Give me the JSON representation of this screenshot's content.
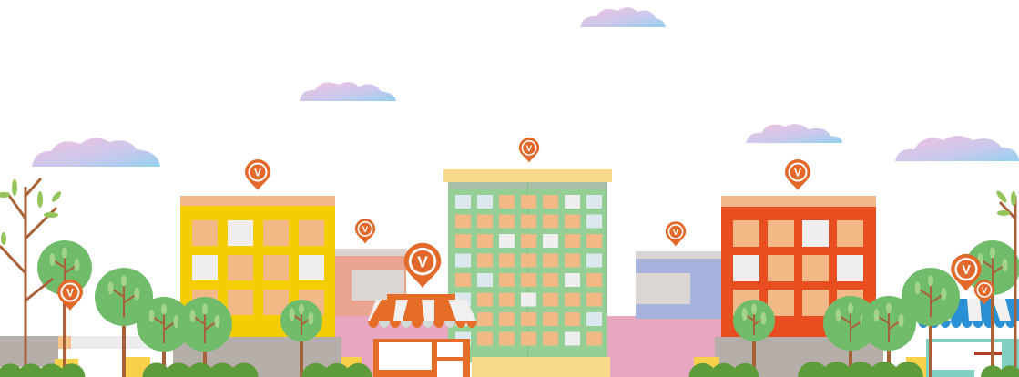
{
  "scene": {
    "palette": {
      "background": "#ffffff",
      "building_yellow": "#f5cd05",
      "building_green": "#96cf95",
      "building_red": "#e94e20",
      "building_blue": "#a6b2dc",
      "building_pink": "#e8a7c0",
      "building_salmon": "#e9a590",
      "roof_peach": "#f2b88a",
      "roof_sand": "#f8d98c",
      "window_peach": "#f2b886",
      "window_light": "#f0eeee",
      "window_pale_blue": "#dbe9ef",
      "awning_orange": "#e66d28",
      "awning_blue": "#2b8fd3",
      "awning_white": "#f2f0ee",
      "pin_orange": "#e3692b",
      "tree_green": "#71bc6b",
      "tree_trunk": "#a8623a",
      "shrub_green": "#5e9b3b",
      "ground_grey": "#b6aea8",
      "cloud_blue": "#9fd0ee",
      "cloud_pink": "#f2c2dd"
    },
    "icons": [
      "location-pin-icon",
      "v-logo-icon",
      "cloud-icon",
      "tree-icon",
      "shop-awning-icon"
    ],
    "pin_letter": "V"
  }
}
